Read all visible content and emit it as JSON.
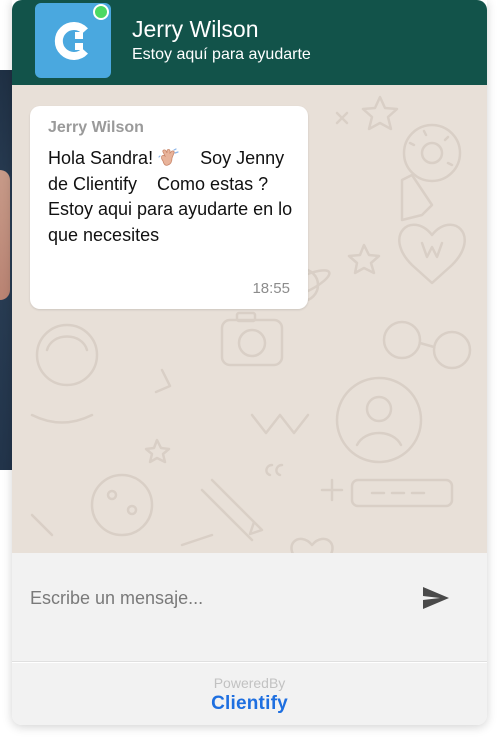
{
  "header": {
    "agent_name": "Jerry Wilson",
    "agent_status": "Estoy aquí para ayudarte",
    "online": true,
    "avatar_icon": "clientify-logo-icon",
    "colors": {
      "header_bg": "#12534a",
      "avatar_bg": "#4aa8df",
      "online_dot": "#4cd964"
    }
  },
  "chat": {
    "background_color": "#e8e0d8",
    "messages": [
      {
        "sender": "Jerry Wilson",
        "text_before_emoji": "Hola Sandra! ",
        "emoji": "waving-hand-icon",
        "text_after_emoji": "    Soy Jenny de Clientify    Como estas ? Estoy aqui para ayudarte en lo que necesites",
        "time": "18:55"
      }
    ]
  },
  "composer": {
    "placeholder": "Escribe un mensaje...",
    "value": "",
    "send_icon": "send-icon"
  },
  "footer": {
    "powered_by": "PoweredBy",
    "brand": "Clientify",
    "brand_color": "#1e6fe0"
  }
}
